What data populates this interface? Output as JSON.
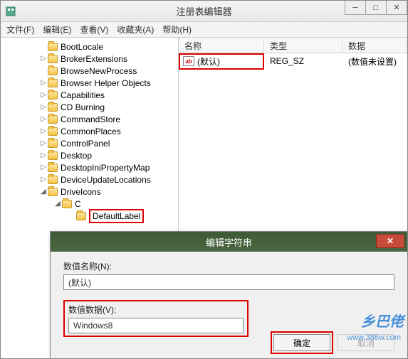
{
  "window": {
    "title": "注册表编辑器"
  },
  "menu": {
    "file": "文件(F)",
    "edit": "编辑(E)",
    "view": "查看(V)",
    "favorites": "收藏夹(A)",
    "help": "帮助(H)"
  },
  "tree": {
    "items": [
      {
        "label": "BootLocale",
        "indent": 54,
        "exp": ""
      },
      {
        "label": "BrokerExtensions",
        "indent": 54,
        "exp": "▷"
      },
      {
        "label": "BrowseNewProcess",
        "indent": 54,
        "exp": ""
      },
      {
        "label": "Browser Helper Objects",
        "indent": 54,
        "exp": "▷"
      },
      {
        "label": "Capabilities",
        "indent": 54,
        "exp": "▷"
      },
      {
        "label": "CD Burning",
        "indent": 54,
        "exp": "▷"
      },
      {
        "label": "CommandStore",
        "indent": 54,
        "exp": "▷"
      },
      {
        "label": "CommonPlaces",
        "indent": 54,
        "exp": "▷"
      },
      {
        "label": "ControlPanel",
        "indent": 54,
        "exp": "▷"
      },
      {
        "label": "Desktop",
        "indent": 54,
        "exp": "▷"
      },
      {
        "label": "DesktopIniPropertyMap",
        "indent": 54,
        "exp": "▷"
      },
      {
        "label": "DeviceUpdateLocations",
        "indent": 54,
        "exp": "▷"
      },
      {
        "label": "DriveIcons",
        "indent": 54,
        "exp": "◢"
      },
      {
        "label": "C",
        "indent": 74,
        "exp": "◢"
      },
      {
        "label": "DefaultLabel",
        "indent": 94,
        "exp": "",
        "highlight": true
      }
    ]
  },
  "list": {
    "headers": {
      "name": "名称",
      "type": "类型",
      "data": "数据"
    },
    "rows": [
      {
        "icon": "ab",
        "name": "(默认)",
        "type": "REG_SZ",
        "data": "(数值未设置)",
        "highlight": true
      }
    ]
  },
  "dialog": {
    "title": "编辑字符串",
    "name_label": "数值名称(N):",
    "name_value": "(默认)",
    "data_label": "数值数据(V):",
    "data_value": "Windows8",
    "ok": "确定",
    "cancel": "取消"
  },
  "watermark": {
    "text": "乡巴佬",
    "url": "www.386w.com"
  }
}
